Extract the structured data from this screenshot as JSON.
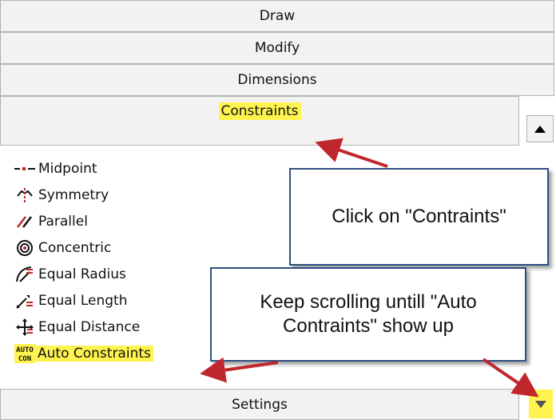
{
  "sections": {
    "draw": "Draw",
    "modify": "Modify",
    "dimensions": "Dimensions",
    "constraints": "Constraints",
    "settings": "Settings"
  },
  "constraints_items": [
    {
      "label": "Midpoint",
      "icon": "midpoint-icon"
    },
    {
      "label": "Symmetry",
      "icon": "symmetry-icon"
    },
    {
      "label": "Parallel",
      "icon": "parallel-icon"
    },
    {
      "label": "Concentric",
      "icon": "concentric-icon"
    },
    {
      "label": "Equal Radius",
      "icon": "equal-radius-icon"
    },
    {
      "label": "Equal Length",
      "icon": "equal-length-icon"
    },
    {
      "label": "Equal Distance",
      "icon": "equal-distance-icon"
    },
    {
      "label": "Auto Constraints",
      "icon": "auto-constraints-icon",
      "icon_text_top": "AUTO",
      "icon_text_bottom": "CON"
    }
  ],
  "callouts": {
    "click_constraints": "Click on \"Contraints\"",
    "keep_scrolling": "Keep scrolling untill \"Auto Contraints\" show up"
  },
  "colors": {
    "highlight": "#fff44f",
    "arrow": "#c0272d",
    "callout_border": "#2f4f80",
    "header_bg": "#f2f2f2"
  }
}
